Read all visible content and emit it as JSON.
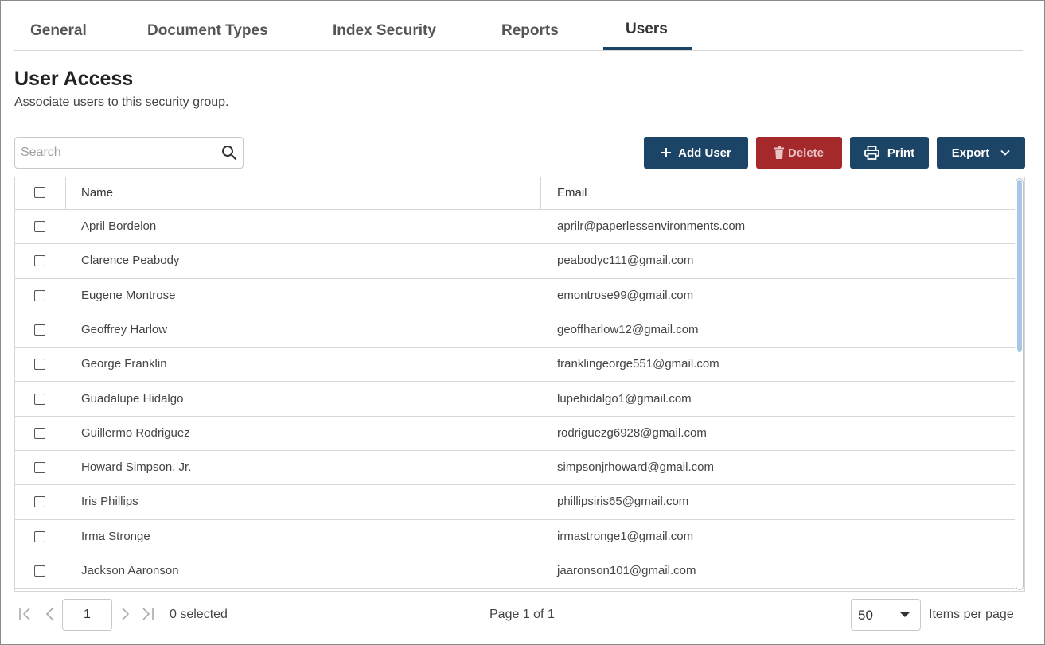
{
  "tabs": [
    {
      "label": "General"
    },
    {
      "label": "Document Types"
    },
    {
      "label": "Index Security"
    },
    {
      "label": "Reports"
    },
    {
      "label": "Users",
      "active": true
    }
  ],
  "page": {
    "title": "User Access",
    "subtitle": "Associate users to this security group."
  },
  "search": {
    "placeholder": "Search",
    "value": ""
  },
  "toolbar": {
    "add_label": "Add User",
    "delete_label": "Delete",
    "print_label": "Print",
    "export_label": "Export"
  },
  "table": {
    "columns": [
      "Name",
      "Email"
    ],
    "rows": [
      {
        "name": "April Bordelon",
        "email": "aprilr@paperlessenvironments.com"
      },
      {
        "name": "Clarence Peabody",
        "email": "peabodyc111@gmail.com"
      },
      {
        "name": "Eugene Montrose",
        "email": "emontrose99@gmail.com"
      },
      {
        "name": "Geoffrey Harlow",
        "email": "geoffharlow12@gmail.com"
      },
      {
        "name": "George Franklin",
        "email": "franklingeorge551@gmail.com"
      },
      {
        "name": "Guadalupe Hidalgo",
        "email": "lupehidalgo1@gmail.com"
      },
      {
        "name": "Guillermo Rodriguez",
        "email": "rodriguezg6928@gmail.com"
      },
      {
        "name": "Howard Simpson, Jr.",
        "email": "simpsonjrhoward@gmail.com"
      },
      {
        "name": "Iris Phillips",
        "email": "phillipsiris65@gmail.com"
      },
      {
        "name": "Irma Stronge",
        "email": "irmastronge1@gmail.com"
      },
      {
        "name": "Jackson Aaronson",
        "email": "jaaronson101@gmail.com"
      }
    ]
  },
  "footer": {
    "page_number": "1",
    "selected_text": "0 selected",
    "page_info": "Page 1 of 1",
    "per_page_value": "50",
    "per_page_label": "Items per page"
  },
  "colors": {
    "primary": "#1c4466",
    "danger": "#a5282b",
    "scroll_thumb": "#a9c6e8"
  },
  "icons": [
    "plus-icon",
    "trash-icon",
    "printer-icon",
    "chevron-down-icon",
    "search-icon",
    "first-page-icon",
    "prev-page-icon",
    "next-page-icon",
    "last-page-icon"
  ]
}
